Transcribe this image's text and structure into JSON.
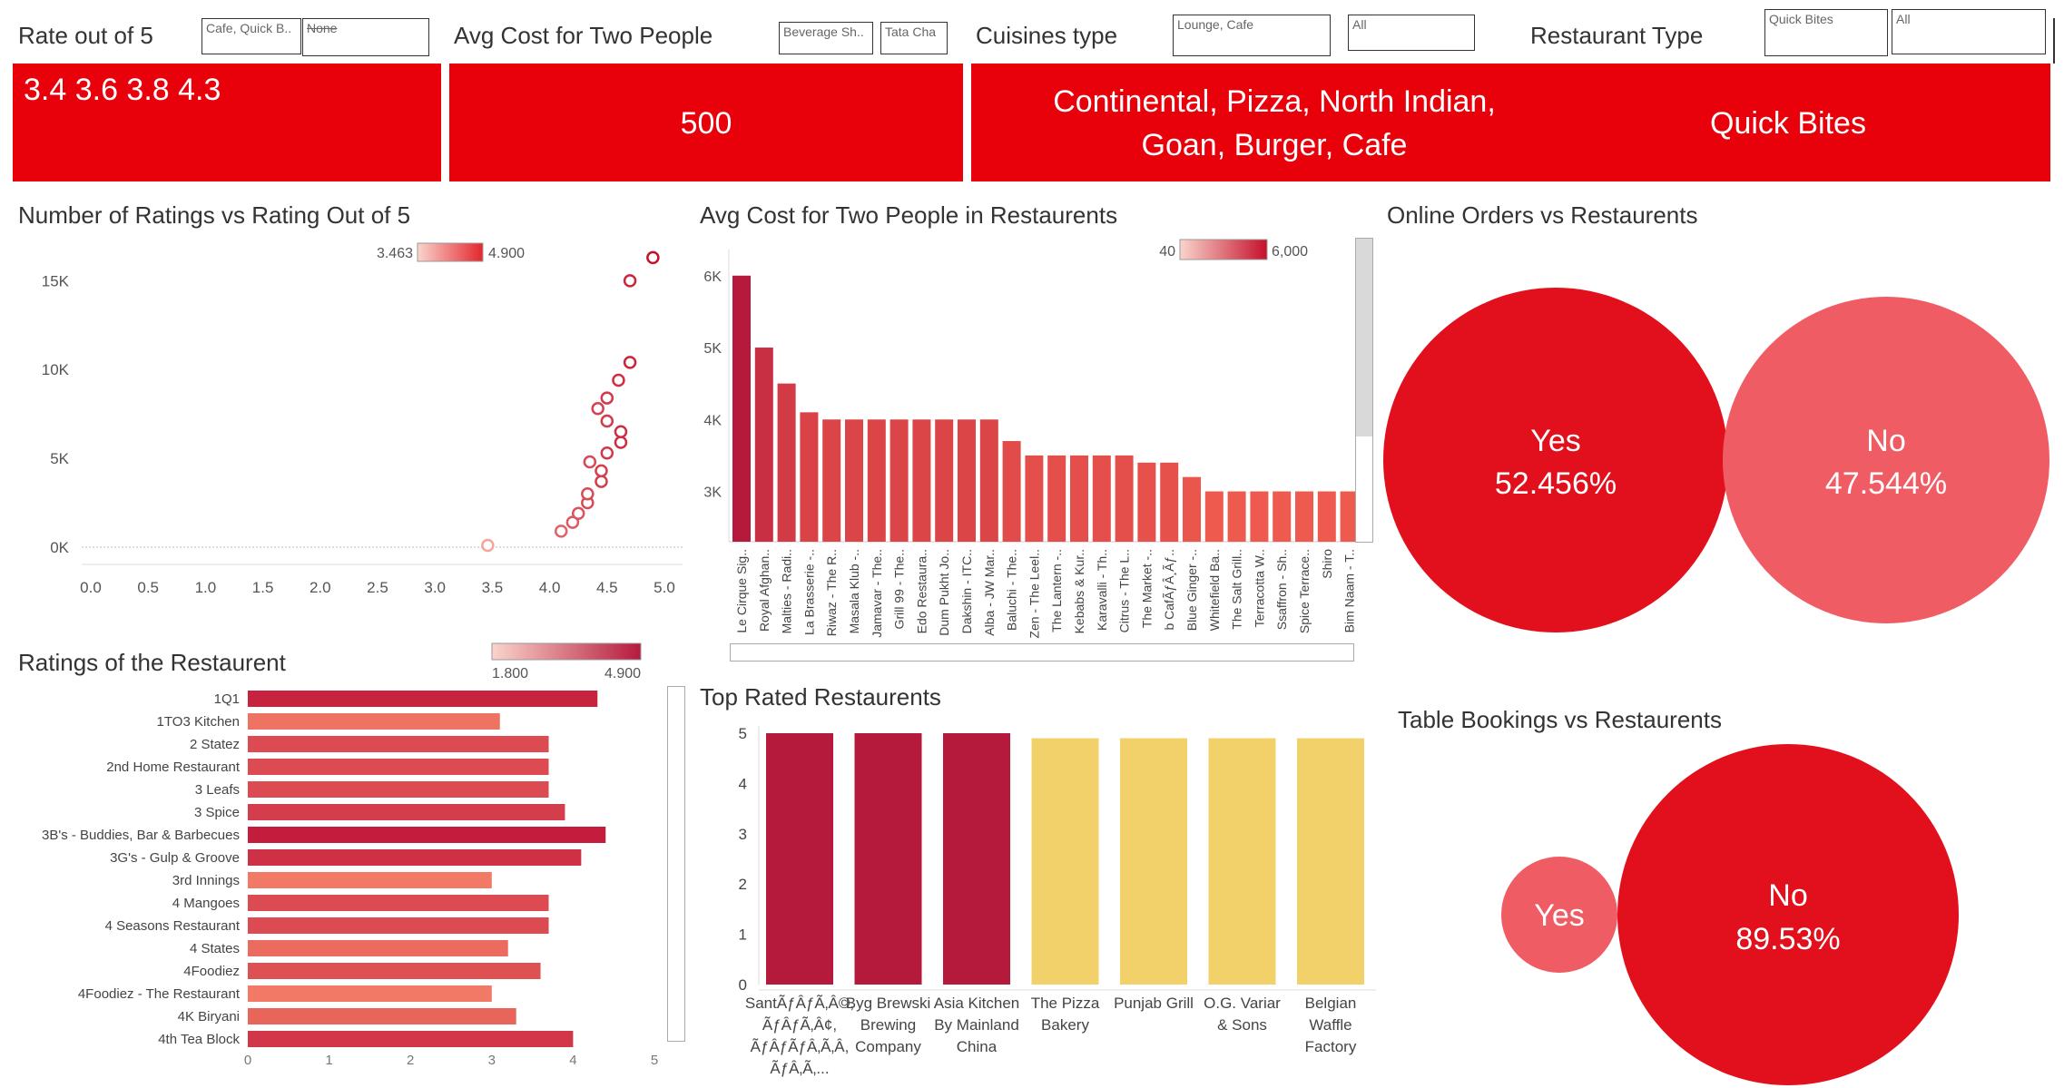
{
  "filters": {
    "rate": {
      "label": "Rate out of 5",
      "box1": "Cafe, Quick B..",
      "box2": "None"
    },
    "cost": {
      "label": "Avg Cost for Two People",
      "box1": "Beverage Sh..",
      "box2": "Tata Cha"
    },
    "cuisines": {
      "label": "Cuisines type",
      "box1": "Lounge, Cafe",
      "box2": "All"
    },
    "rtype": {
      "label": "Restaurant Type",
      "box1": "Quick Bites",
      "box2": "All"
    }
  },
  "kpis": {
    "rate": "3.4 3.6 3.8 4.3",
    "cost": "500",
    "cuisines_line1": "Continental, Pizza, North Indian,",
    "cuisines_line2": "Goan, Burger, Cafe",
    "rtype": "Quick Bites"
  },
  "colors": {
    "accent": "#e8000a",
    "dark_red": "#b51a3c",
    "light_red": "#f26a60",
    "yellow": "#f2d16b",
    "pink": "#f05c64"
  },
  "chart_data": [
    {
      "id": "scatter",
      "type": "scatter",
      "title": "Number of Ratings vs Rating Out of 5",
      "legend": {
        "min_label": "3.463",
        "max_label": "4.900",
        "min": 3.463,
        "max": 4.9
      },
      "xticks": [
        "0.0",
        "0.5",
        "1.0",
        "1.5",
        "2.0",
        "2.5",
        "3.0",
        "3.5",
        "4.0",
        "4.5",
        "5.0"
      ],
      "yticks": [
        "0K",
        "5K",
        "10K",
        "15K"
      ],
      "xlim": [
        0,
        5
      ],
      "ylim": [
        0,
        16500
      ],
      "points": [
        {
          "x": 3.46,
          "y": 100
        },
        {
          "x": 4.1,
          "y": 900
        },
        {
          "x": 4.2,
          "y": 1400
        },
        {
          "x": 4.25,
          "y": 1900
        },
        {
          "x": 4.33,
          "y": 2500
        },
        {
          "x": 4.33,
          "y": 3000
        },
        {
          "x": 4.45,
          "y": 3700
        },
        {
          "x": 4.45,
          "y": 4300
        },
        {
          "x": 4.35,
          "y": 4800
        },
        {
          "x": 4.5,
          "y": 5300
        },
        {
          "x": 4.62,
          "y": 5900
        },
        {
          "x": 4.62,
          "y": 6500
        },
        {
          "x": 4.5,
          "y": 7100
        },
        {
          "x": 4.42,
          "y": 7800
        },
        {
          "x": 4.5,
          "y": 8400
        },
        {
          "x": 4.6,
          "y": 9400
        },
        {
          "x": 4.7,
          "y": 10400
        },
        {
          "x": 4.7,
          "y": 15000
        },
        {
          "x": 4.9,
          "y": 16300
        }
      ]
    },
    {
      "id": "costbars",
      "type": "bar",
      "title": "Avg Cost for Two People in Restaurents",
      "legend": {
        "min_label": "40",
        "max_label": "6,000",
        "min": 40,
        "max": 6000
      },
      "yticks": [
        "3K",
        "4K",
        "5K",
        "6K"
      ],
      "ylim": [
        2300,
        6300
      ],
      "categories": [
        "Le Cirque Sig..",
        "Royal Afghan..",
        "Malties - Radi..",
        "La Brasserie -..",
        "Riwaz - The R..",
        "Masala Klub -..",
        "Jamavar - The..",
        "Grill 99 - The..",
        "Edo Restaura..",
        "Dum Pukht Jo..",
        "Dakshin - ITC..",
        "Alba - JW Mar..",
        "Baluchi - The..",
        "Zen - The Leel..",
        "The Lantern -..",
        "Kebabs & Kur..",
        "Karavalli - Th..",
        "Citrus - The L..",
        "The Market -..",
        "b CafÃƒÂ¸Ãƒ..",
        "Blue Ginger -..",
        "Whitefield Ba..",
        "The Salt Grill..",
        "Terracotta W..",
        "Ssaffron - Sh..",
        "Spice Terrace..",
        "Shiro",
        "Bim Naam - T.."
      ],
      "values": [
        6000,
        5000,
        4500,
        4100,
        4000,
        4000,
        4000,
        4000,
        4000,
        4000,
        4000,
        4000,
        3700,
        3500,
        3500,
        3500,
        3500,
        3500,
        3400,
        3400,
        3200,
        3000,
        3000,
        3000,
        3000,
        3000,
        3000,
        3000
      ]
    },
    {
      "id": "online",
      "type": "bubble",
      "title": "Online Orders vs Restaurents",
      "categories": [
        "Yes",
        "No"
      ],
      "values": [
        52.456,
        47.544
      ],
      "labels": [
        "52.456%",
        "47.544%"
      ]
    },
    {
      "id": "ratings",
      "type": "bar",
      "title": "Ratings of the Restaurent",
      "legend": {
        "min_label": "1.800",
        "max_label": "4.900",
        "min": 1.8,
        "max": 4.9
      },
      "xticks": [
        "0",
        "1",
        "2",
        "3",
        "4",
        "5"
      ],
      "xlim": [
        0,
        5
      ],
      "categories": [
        "1Q1",
        "1TO3 Kitchen",
        "2 Statez",
        "2nd Home Restaurant",
        "3 Leafs",
        "3 Spice",
        "3B's - Buddies, Bar & Barbecues",
        "3G's - Gulp & Groove",
        "3rd Innings",
        "4 Mangoes",
        "4 Seasons Restaurant",
        "4 States",
        "4Foodiez",
        "4Foodiez - The Restaurant",
        "4K Biryani",
        "4th Tea Block"
      ],
      "values": [
        4.3,
        3.1,
        3.7,
        3.7,
        3.7,
        3.9,
        4.4,
        4.1,
        3.0,
        3.7,
        3.7,
        3.2,
        3.6,
        3.0,
        3.3,
        4.0
      ]
    },
    {
      "id": "toprated",
      "type": "bar",
      "title": "Top Rated Restaurents",
      "yticks": [
        "0",
        "1",
        "2",
        "3",
        "4",
        "5"
      ],
      "ylim": [
        0,
        5
      ],
      "categories": [
        [
          "SantÃƒÂƒÃ‚Â©,",
          "ÃƒÂƒÃ‚Â¢,",
          "ÃƒÂƒÃƒÂ‚Ã‚Â,",
          "ÃƒÂ‚Ã‚..."
        ],
        [
          "Byg Brewski",
          "Brewing",
          "Company"
        ],
        [
          "Asia Kitchen",
          "By Mainland",
          "China"
        ],
        [
          "The Pizza",
          "Bakery"
        ],
        [
          "Punjab Grill"
        ],
        [
          "O.G. Variar",
          "& Sons"
        ],
        [
          "Belgian",
          "Waffle",
          "Factory"
        ]
      ],
      "values": [
        5.0,
        5.0,
        5.0,
        4.9,
        4.9,
        4.9,
        4.9
      ]
    },
    {
      "id": "table",
      "type": "bubble",
      "title": "Table Bookings vs Restaurents",
      "categories": [
        "Yes",
        "No"
      ],
      "values": [
        10.47,
        89.53
      ],
      "labels": [
        "",
        "89.53%"
      ]
    }
  ]
}
